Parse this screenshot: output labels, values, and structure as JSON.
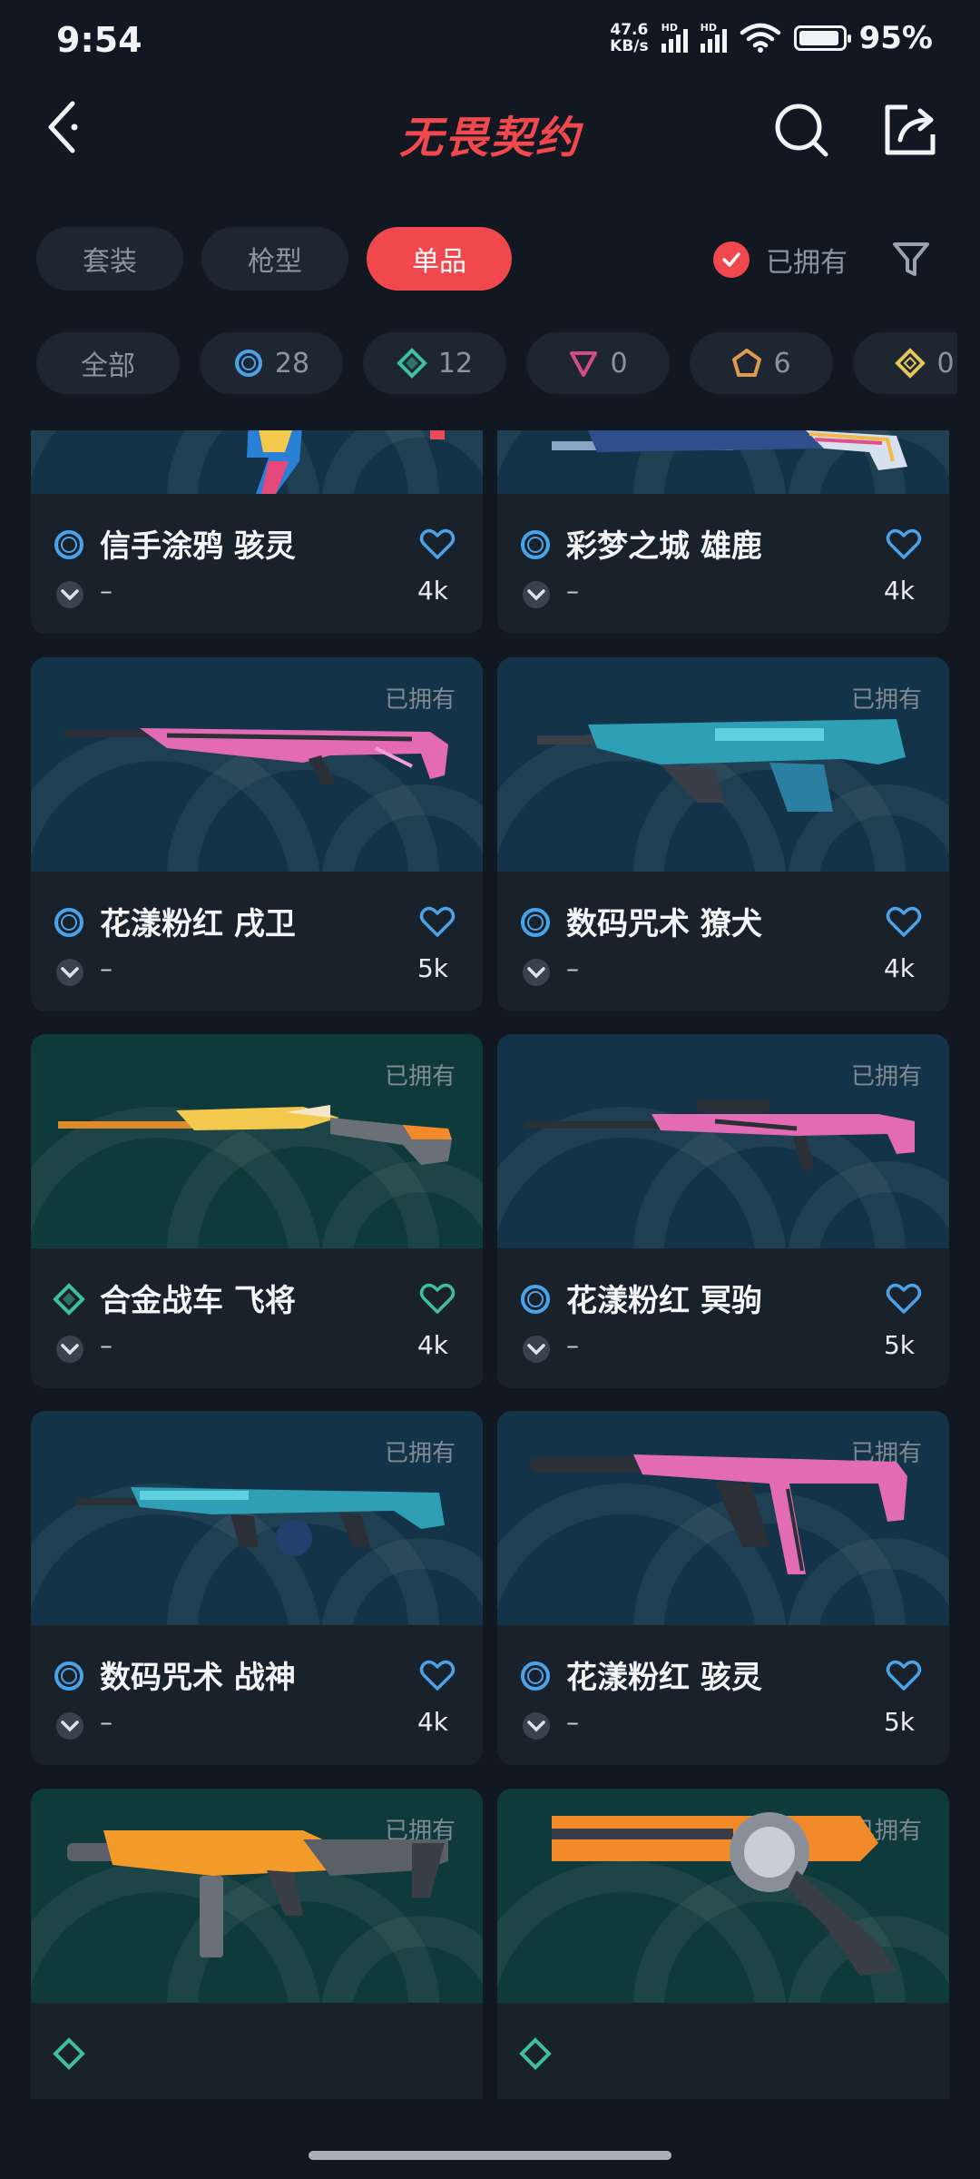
{
  "status": {
    "time": "9:54",
    "net_speed": "47.6",
    "net_unit": "KB/s",
    "signal_1": "HD",
    "signal_2": "HD",
    "battery": "95%"
  },
  "header": {
    "logo": "无畏契约",
    "back_icon": "chevron-left-icon",
    "search_icon": "search-icon",
    "share_icon": "share-icon"
  },
  "tabs": [
    {
      "label": "套装",
      "selected": false
    },
    {
      "label": "枪型",
      "selected": false
    },
    {
      "label": "单品",
      "selected": true
    }
  ],
  "owned_filter": {
    "label": "已拥有",
    "checked": true
  },
  "rarity_chips": [
    {
      "label": "全部"
    },
    {
      "label": "28",
      "tier": "select",
      "color": "#4aa3e8"
    },
    {
      "label": "12",
      "tier": "deluxe",
      "color": "#3fbf9f"
    },
    {
      "label": "0",
      "tier": "premium",
      "color": "#d14d8a"
    },
    {
      "label": "6",
      "tier": "exclusive",
      "color": "#e09a4f"
    },
    {
      "label": "0",
      "tier": "ultra",
      "color": "#e3c65a"
    }
  ],
  "colors": {
    "accent": "#f0484c",
    "select_tier": "#4aa3e8",
    "deluxe_tier": "#3fbf9f",
    "card_bg": "#19212b",
    "page_bg": "#111821"
  },
  "skins": [
    {
      "name": "信手涂鸦 骇灵",
      "level": "–",
      "likes": "4k",
      "owned_label": "",
      "tier": "select"
    },
    {
      "name": "彩梦之城 雄鹿",
      "level": "–",
      "likes": "4k",
      "owned_label": "",
      "tier": "select"
    },
    {
      "name": "花漾粉红 戌卫",
      "level": "–",
      "likes": "5k",
      "owned_label": "已拥有",
      "tier": "select"
    },
    {
      "name": "数码咒术 獠犬",
      "level": "–",
      "likes": "4k",
      "owned_label": "已拥有",
      "tier": "select"
    },
    {
      "name": "合金战车 飞将",
      "level": "–",
      "likes": "4k",
      "owned_label": "已拥有",
      "tier": "deluxe"
    },
    {
      "name": "花漾粉红 冥驹",
      "level": "–",
      "likes": "5k",
      "owned_label": "已拥有",
      "tier": "select"
    },
    {
      "name": "数码咒术 战神",
      "level": "–",
      "likes": "4k",
      "owned_label": "已拥有",
      "tier": "select"
    },
    {
      "name": "花漾粉红 骇灵",
      "level": "–",
      "likes": "5k",
      "owned_label": "已拥有",
      "tier": "select"
    },
    {
      "name": "",
      "level": "",
      "likes": "",
      "owned_label": "已拥有",
      "tier": "deluxe"
    },
    {
      "name": "",
      "level": "",
      "likes": "",
      "owned_label": "已拥有",
      "tier": "deluxe"
    }
  ]
}
